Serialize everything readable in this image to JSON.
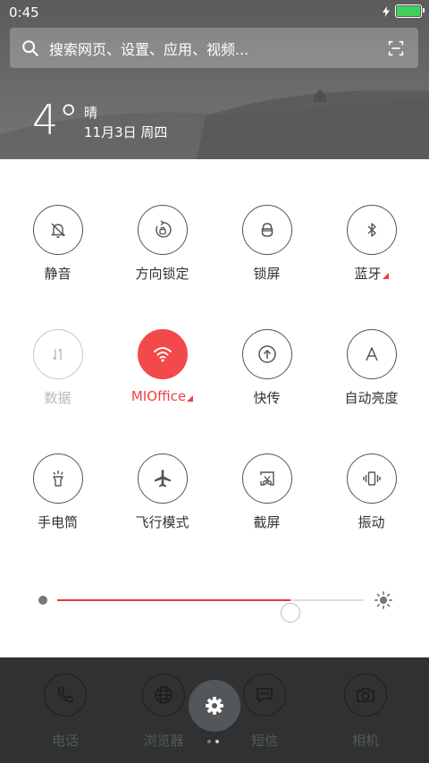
{
  "status_bar": {
    "time": "0:45"
  },
  "search": {
    "placeholder": "搜索网页、设置、应用、视频..."
  },
  "weather": {
    "temperature": "4°",
    "condition": "晴",
    "date": "11月3日 周四"
  },
  "toggles": [
    {
      "label": "静音",
      "icon": "bell-off-icon",
      "state": "off"
    },
    {
      "label": "方向锁定",
      "icon": "rotation-lock-icon",
      "state": "off"
    },
    {
      "label": "锁屏",
      "icon": "lock-icon",
      "state": "off"
    },
    {
      "label": "蓝牙",
      "icon": "bluetooth-icon",
      "state": "off"
    },
    {
      "label": "数据",
      "icon": "mobile-data-icon",
      "state": "disabled"
    },
    {
      "label": "MIOffice",
      "icon": "wifi-icon",
      "state": "on"
    },
    {
      "label": "快传",
      "icon": "share-transfer-icon",
      "state": "off"
    },
    {
      "label": "自动亮度",
      "icon": "auto-brightness-icon",
      "state": "off"
    },
    {
      "label": "手电筒",
      "icon": "flashlight-icon",
      "state": "off"
    },
    {
      "label": "飞行模式",
      "icon": "airplane-icon",
      "state": "off"
    },
    {
      "label": "截屏",
      "icon": "screenshot-icon",
      "state": "off"
    },
    {
      "label": "振动",
      "icon": "vibrate-icon",
      "state": "off"
    }
  ],
  "brightness": {
    "level": 0.76
  },
  "dock": {
    "apps": [
      {
        "label": "电话",
        "icon": "phone-icon"
      },
      {
        "label": "浏览器",
        "icon": "globe-icon"
      },
      {
        "label": "短信",
        "icon": "message-icon"
      },
      {
        "label": "相机",
        "icon": "camera-icon"
      }
    ],
    "settings_icon": "gear-icon"
  },
  "colors": {
    "accent": "#f24a4a",
    "dock_bg": "#2f3132",
    "battery": "#3ed05a"
  }
}
